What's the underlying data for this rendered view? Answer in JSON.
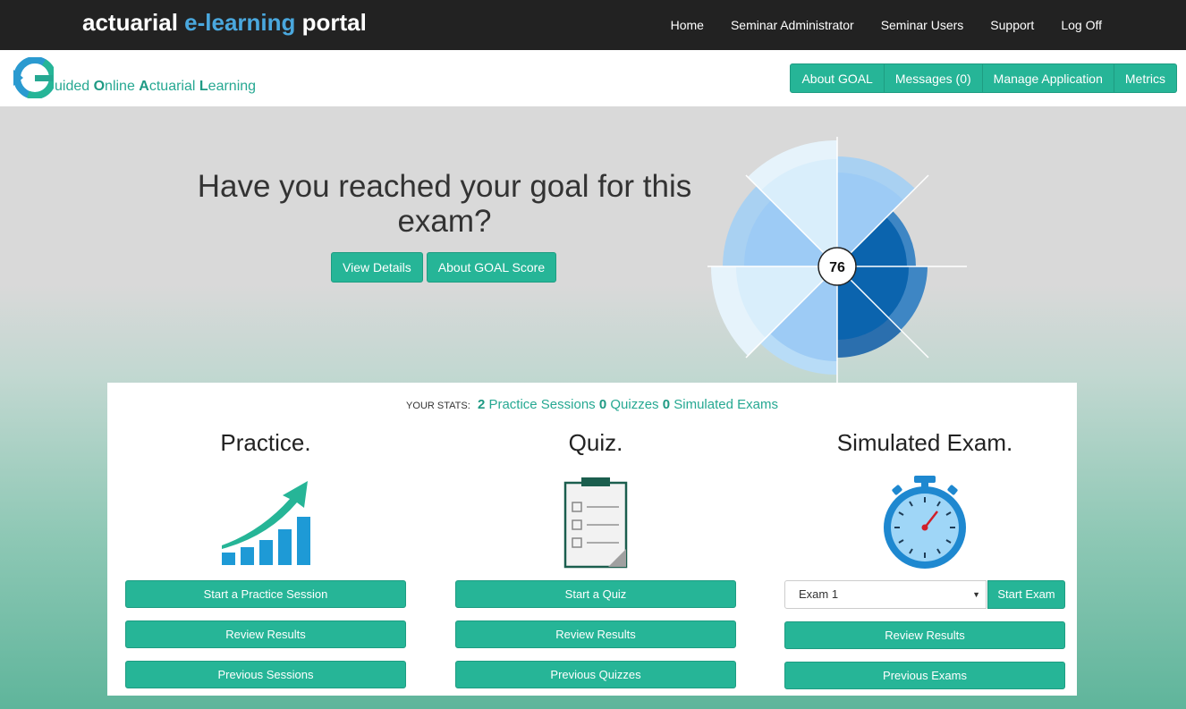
{
  "topbar": {
    "brand_prefix": "actuarial ",
    "brand_accent": "e-learning",
    "brand_suffix": " portal",
    "nav": [
      "Home",
      "Seminar Administrator",
      "Seminar Users",
      "Support",
      "Log Off"
    ]
  },
  "subheader": {
    "logo_text": [
      {
        "cap": "",
        "rest": "uided "
      },
      {
        "cap": "O",
        "rest": "nline "
      },
      {
        "cap": "A",
        "rest": "ctuarial "
      },
      {
        "cap": "L",
        "rest": "earning"
      }
    ],
    "buttons": [
      "About GOAL",
      "Messages (0)",
      "Manage Application",
      "Metrics"
    ]
  },
  "hero": {
    "title": "Have you reached your goal for this exam?",
    "view_details": "View Details",
    "about_score": "About GOAL Score",
    "score": "76"
  },
  "stats": {
    "label": "YOUR STATS:",
    "practice_count": "2",
    "practice_label": "Practice Sessions",
    "quiz_count": "0",
    "quiz_label": "Quizzes",
    "exam_count": "0",
    "exam_label": "Simulated Exams"
  },
  "practice": {
    "title": "Practice.",
    "start": "Start a Practice Session",
    "review": "Review Results",
    "previous": "Previous Sessions"
  },
  "quiz": {
    "title": "Quiz.",
    "start": "Start a Quiz",
    "review": "Review Results",
    "previous": "Previous Quizzes"
  },
  "exam": {
    "title": "Simulated Exam.",
    "selected": "Exam 1",
    "start": "Start Exam",
    "review": "Review Results",
    "previous": "Previous Exams"
  },
  "colors": {
    "accent": "#26b597",
    "brand_blue": "#4aa8de",
    "dark_bar": "#222222"
  }
}
